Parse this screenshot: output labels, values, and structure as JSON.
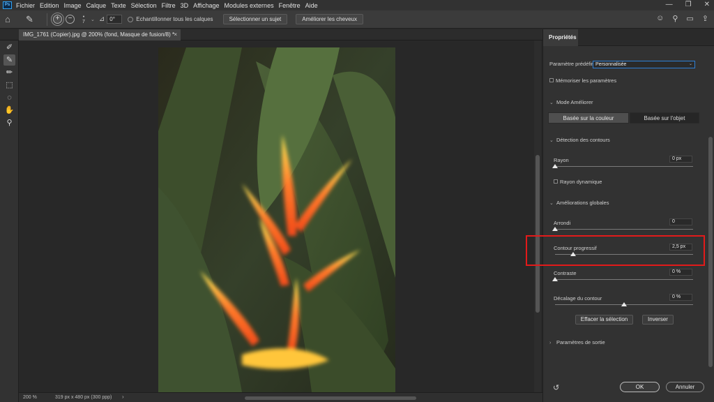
{
  "menubar": {
    "logo": "Ps",
    "items": [
      "Fichier",
      "Edition",
      "Image",
      "Calque",
      "Texte",
      "Sélection",
      "Filtre",
      "3D",
      "Affichage",
      "Modules externes",
      "Fenêtre",
      "Aide"
    ],
    "window_controls": [
      "—",
      "❐",
      "✕"
    ]
  },
  "options_bar": {
    "brush_size": "7",
    "angle_value": "0°",
    "sample_all_layers_label": "Echantillonner tous les calques",
    "select_subject_label": "Sélectionner un sujet",
    "refine_hair_label": "Améliorer les cheveux"
  },
  "document": {
    "tab_title": "IMG_1761 (Copier).jpg @ 200% (fond, Masque de fusion/8) *",
    "close": "×"
  },
  "status": {
    "zoom": "200 %",
    "doc_info": "319 px x 480 px (300 ppp)",
    "arrow": "›"
  },
  "panel": {
    "tab": "Propriétés",
    "preset_label": "Paramètre prédéfini",
    "preset_value": "Personnalisée",
    "remember_label": "Mémoriser les paramètres",
    "mode_section": "Mode Améliorer",
    "mode_color": "Basée sur la couleur",
    "mode_object": "Basée sur l'objet",
    "edge_section": "Détection des contours",
    "radius_label": "Rayon",
    "radius_value": "0 px",
    "smart_radius_label": "Rayon dynamique",
    "global_section": "Améliorations globales",
    "smooth_label": "Arrondi",
    "smooth_value": "0",
    "feather_label": "Contour progressif",
    "feather_value": "2,5 px",
    "contrast_label": "Contraste",
    "contrast_value": "0 %",
    "shift_label": "Décalage du contour",
    "shift_value": "0 %",
    "clear_selection": "Effacer la sélection",
    "invert": "Inverser",
    "output_section": "Paramètres de sortie",
    "ok": "OK",
    "cancel": "Annuler"
  },
  "sliders": {
    "radius": 0,
    "smooth": 0,
    "feather": 0.13,
    "contrast": 0,
    "shift": 0.5
  },
  "colors": {
    "highlight": "#e31a1a",
    "preset_border": "#2e7fd5"
  }
}
